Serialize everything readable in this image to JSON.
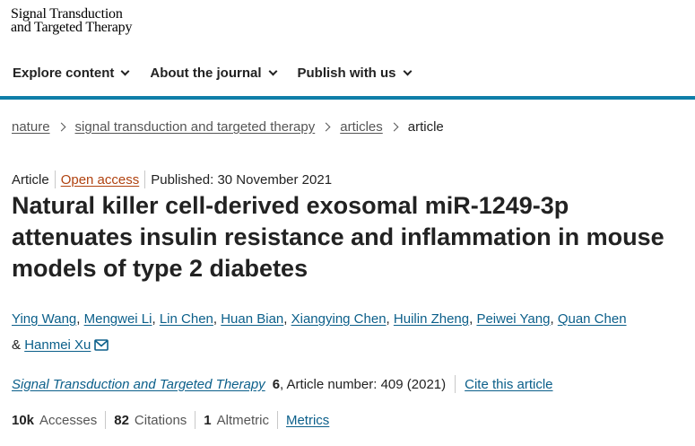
{
  "masthead": {
    "line1": "Signal Transduction",
    "line2": "and Targeted Therapy"
  },
  "nav": {
    "items": [
      {
        "label": "Explore content"
      },
      {
        "label": "About the journal"
      },
      {
        "label": "Publish with us"
      }
    ],
    "accent": "#0f7ea8"
  },
  "breadcrumb": [
    {
      "label": "nature"
    },
    {
      "label": "signal transduction and targeted therapy"
    },
    {
      "label": "articles"
    },
    {
      "label": "article"
    }
  ],
  "meta": {
    "type": "Article",
    "access": "Open access",
    "published": "Published: 30 November 2021"
  },
  "title": "Natural killer cell-derived exosomal miR-1249-3p attenuates insulin resistance and inflammation in mouse models of type 2 diabetes",
  "authors": [
    "Ying Wang",
    "Mengwei Li",
    "Lin Chen",
    "Huan Bian",
    "Xiangying Chen",
    "Huilin Zheng",
    "Peiwei Yang",
    "Quan Chen",
    "Hanmei Xu"
  ],
  "author_separator": ",",
  "author_and": "&",
  "citation": {
    "journal": "Signal Transduction and Targeted Therapy",
    "volume": "6",
    "article_number": ", Article number: 409 (2021)",
    "cite_label": "Cite this article"
  },
  "metrics": {
    "accesses_value": "10k",
    "accesses_label": "Accesses",
    "citations_value": "82",
    "citations_label": "Citations",
    "altmetric_value": "1",
    "altmetric_label": "Altmetric",
    "metrics_link": "Metrics"
  },
  "colors": {
    "link": "#0b5f8a",
    "open_access": "#b0420f"
  },
  "icons": {
    "email": "envelope-icon",
    "nav_chevron": "chevron-down-icon",
    "crumb_sep": "chevron-right-icon"
  }
}
